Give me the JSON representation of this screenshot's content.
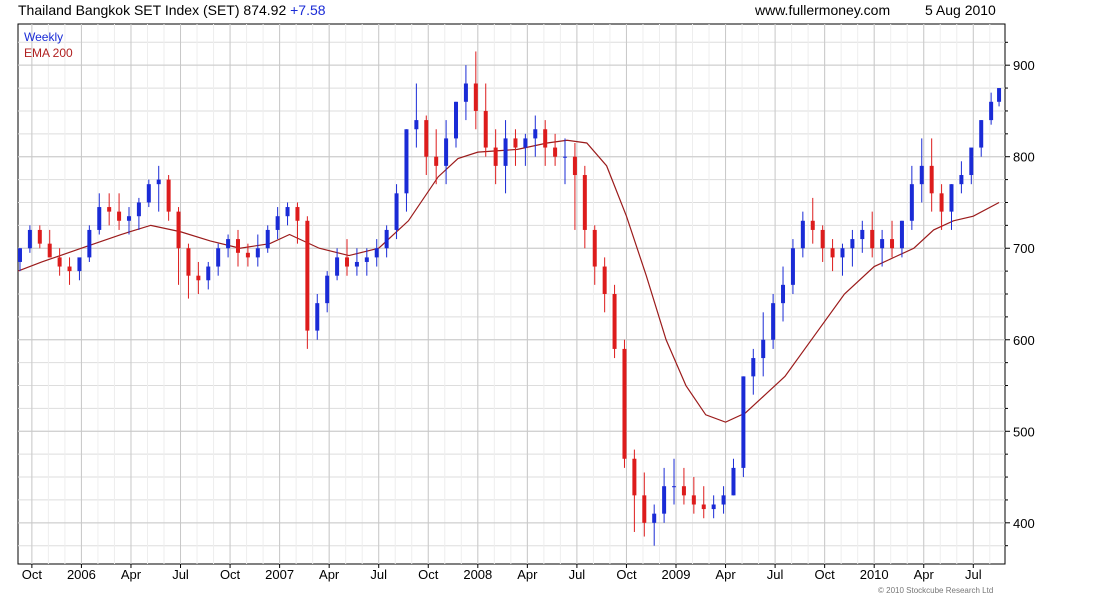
{
  "header": {
    "title": "Thailand Bangkok SET Index (SET) 874.92",
    "change": "+7.58",
    "site": "www.fullermoney.com",
    "date": "5 Aug 2010"
  },
  "legend": {
    "weekly": "Weekly",
    "ema": "EMA 200"
  },
  "copyright": "© 2010 Stockcube Research Ltd",
  "colors": {
    "up": "#1a2bd6",
    "down": "#dd1c1c",
    "ema": "#9b1b1b",
    "grid": "#dddddd"
  },
  "chart_data": {
    "type": "candlestick",
    "ylim": [
      355,
      945
    ],
    "xlim": [
      2005.68,
      2010.66
    ],
    "y_ticks": [
      400,
      500,
      600,
      700,
      800,
      900
    ],
    "x_ticks": [
      {
        "label": "Oct",
        "x": 2005.75
      },
      {
        "label": "2006",
        "x": 2006.0
      },
      {
        "label": "Apr",
        "x": 2006.25
      },
      {
        "label": "Jul",
        "x": 2006.5
      },
      {
        "label": "Oct",
        "x": 2006.75
      },
      {
        "label": "2007",
        "x": 2007.0
      },
      {
        "label": "Apr",
        "x": 2007.25
      },
      {
        "label": "Jul",
        "x": 2007.5
      },
      {
        "label": "Oct",
        "x": 2007.75
      },
      {
        "label": "2008",
        "x": 2008.0
      },
      {
        "label": "Apr",
        "x": 2008.25
      },
      {
        "label": "Jul",
        "x": 2008.5
      },
      {
        "label": "Oct",
        "x": 2008.75
      },
      {
        "label": "2009",
        "x": 2009.0
      },
      {
        "label": "Apr",
        "x": 2009.25
      },
      {
        "label": "Jul",
        "x": 2009.5
      },
      {
        "label": "Oct",
        "x": 2009.75
      },
      {
        "label": "2010",
        "x": 2010.0
      },
      {
        "label": "Apr",
        "x": 2010.25
      },
      {
        "label": "Jul",
        "x": 2010.5
      }
    ],
    "series": [
      {
        "name": "Weekly",
        "x": [
          2005.69,
          2005.74,
          2005.79,
          2005.84,
          2005.89,
          2005.94,
          2005.99,
          2006.04,
          2006.09,
          2006.14,
          2006.19,
          2006.24,
          2006.29,
          2006.34,
          2006.39,
          2006.44,
          2006.49,
          2006.54,
          2006.59,
          2006.64,
          2006.69,
          2006.74,
          2006.79,
          2006.84,
          2006.89,
          2006.94,
          2006.99,
          2007.04,
          2007.09,
          2007.14,
          2007.19,
          2007.24,
          2007.29,
          2007.34,
          2007.39,
          2007.44,
          2007.49,
          2007.54,
          2007.59,
          2007.64,
          2007.69,
          2007.74,
          2007.79,
          2007.84,
          2007.89,
          2007.94,
          2007.99,
          2008.04,
          2008.09,
          2008.14,
          2008.19,
          2008.24,
          2008.29,
          2008.34,
          2008.39,
          2008.44,
          2008.49,
          2008.54,
          2008.59,
          2008.64,
          2008.69,
          2008.74,
          2008.79,
          2008.84,
          2008.89,
          2008.94,
          2008.99,
          2009.04,
          2009.09,
          2009.14,
          2009.19,
          2009.24,
          2009.29,
          2009.34,
          2009.39,
          2009.44,
          2009.49,
          2009.54,
          2009.59,
          2009.64,
          2009.69,
          2009.74,
          2009.79,
          2009.84,
          2009.89,
          2009.94,
          2009.99,
          2010.04,
          2010.09,
          2010.14,
          2010.19,
          2010.24,
          2010.29,
          2010.34,
          2010.39,
          2010.44,
          2010.49,
          2010.54,
          2010.59,
          2010.63
        ],
        "open": [
          685,
          700,
          720,
          705,
          690,
          680,
          675,
          690,
          720,
          745,
          740,
          730,
          735,
          750,
          770,
          775,
          740,
          700,
          670,
          665,
          680,
          700,
          710,
          695,
          690,
          700,
          720,
          735,
          745,
          730,
          610,
          640,
          670,
          690,
          680,
          685,
          690,
          700,
          720,
          760,
          830,
          840,
          800,
          790,
          820,
          860,
          880,
          850,
          810,
          790,
          820,
          810,
          820,
          830,
          810,
          800,
          800,
          780,
          720,
          680,
          650,
          590,
          470,
          430,
          400,
          410,
          440,
          440,
          430,
          420,
          415,
          420,
          430,
          460,
          560,
          580,
          600,
          640,
          660,
          700,
          730,
          720,
          700,
          690,
          700,
          710,
          720,
          700,
          710,
          700,
          730,
          770,
          790,
          760,
          740,
          770,
          780,
          810,
          840,
          860
        ],
        "high": [
          700,
          725,
          725,
          720,
          700,
          690,
          685,
          725,
          760,
          760,
          760,
          745,
          755,
          775,
          790,
          780,
          745,
          705,
          685,
          685,
          705,
          715,
          720,
          705,
          715,
          725,
          745,
          750,
          750,
          735,
          650,
          675,
          700,
          710,
          700,
          700,
          710,
          725,
          770,
          830,
          880,
          845,
          830,
          840,
          860,
          900,
          915,
          880,
          830,
          840,
          830,
          825,
          845,
          840,
          825,
          820,
          815,
          790,
          725,
          690,
          660,
          600,
          480,
          455,
          420,
          460,
          470,
          460,
          450,
          440,
          430,
          440,
          470,
          560,
          590,
          630,
          650,
          680,
          710,
          740,
          755,
          725,
          710,
          705,
          720,
          730,
          740,
          720,
          730,
          730,
          790,
          820,
          820,
          770,
          770,
          795,
          805,
          840,
          870,
          875
        ],
        "low": [
          675,
          695,
          700,
          690,
          670,
          660,
          665,
          685,
          715,
          725,
          720,
          715,
          720,
          745,
          740,
          730,
          660,
          645,
          650,
          655,
          670,
          690,
          680,
          680,
          680,
          695,
          710,
          725,
          705,
          590,
          600,
          630,
          665,
          670,
          670,
          670,
          680,
          690,
          710,
          740,
          810,
          780,
          770,
          770,
          810,
          840,
          830,
          800,
          770,
          760,
          790,
          790,
          800,
          790,
          790,
          770,
          720,
          700,
          660,
          630,
          580,
          460,
          390,
          385,
          375,
          400,
          420,
          420,
          410,
          405,
          405,
          410,
          430,
          450,
          540,
          560,
          590,
          620,
          650,
          690,
          705,
          685,
          675,
          670,
          680,
          695,
          690,
          680,
          690,
          690,
          720,
          750,
          740,
          720,
          720,
          760,
          770,
          800,
          835,
          855
        ],
        "close": [
          700,
          720,
          705,
          690,
          680,
          675,
          690,
          720,
          745,
          740,
          730,
          735,
          750,
          770,
          775,
          740,
          700,
          670,
          665,
          680,
          700,
          710,
          695,
          690,
          700,
          720,
          735,
          745,
          730,
          610,
          640,
          670,
          690,
          680,
          685,
          690,
          700,
          720,
          760,
          830,
          840,
          800,
          790,
          820,
          860,
          880,
          850,
          810,
          790,
          820,
          810,
          820,
          830,
          810,
          800,
          800,
          780,
          720,
          680,
          650,
          590,
          470,
          430,
          400,
          410,
          440,
          440,
          430,
          420,
          415,
          420,
          430,
          460,
          560,
          580,
          600,
          640,
          660,
          700,
          730,
          720,
          700,
          690,
          700,
          710,
          720,
          700,
          710,
          700,
          730,
          770,
          790,
          760,
          740,
          770,
          780,
          810,
          840,
          860,
          875
        ]
      },
      {
        "name": "EMA 200",
        "x": [
          2005.68,
          2005.8,
          2006.0,
          2006.2,
          2006.35,
          2006.5,
          2006.65,
          2006.8,
          2006.95,
          2007.05,
          2007.2,
          2007.35,
          2007.5,
          2007.65,
          2007.8,
          2007.9,
          2008.0,
          2008.2,
          2008.35,
          2008.45,
          2008.55,
          2008.65,
          2008.75,
          2008.85,
          2008.95,
          2009.05,
          2009.15,
          2009.25,
          2009.35,
          2009.45,
          2009.55,
          2009.7,
          2009.85,
          2010.0,
          2010.1,
          2010.2,
          2010.3,
          2010.4,
          2010.5,
          2010.63
        ],
        "y": [
          675,
          685,
          700,
          715,
          725,
          718,
          708,
          700,
          705,
          715,
          700,
          692,
          700,
          730,
          778,
          798,
          805,
          808,
          815,
          818,
          815,
          790,
          735,
          670,
          600,
          550,
          518,
          510,
          520,
          540,
          560,
          605,
          650,
          680,
          690,
          700,
          720,
          730,
          735,
          750
        ]
      }
    ]
  }
}
